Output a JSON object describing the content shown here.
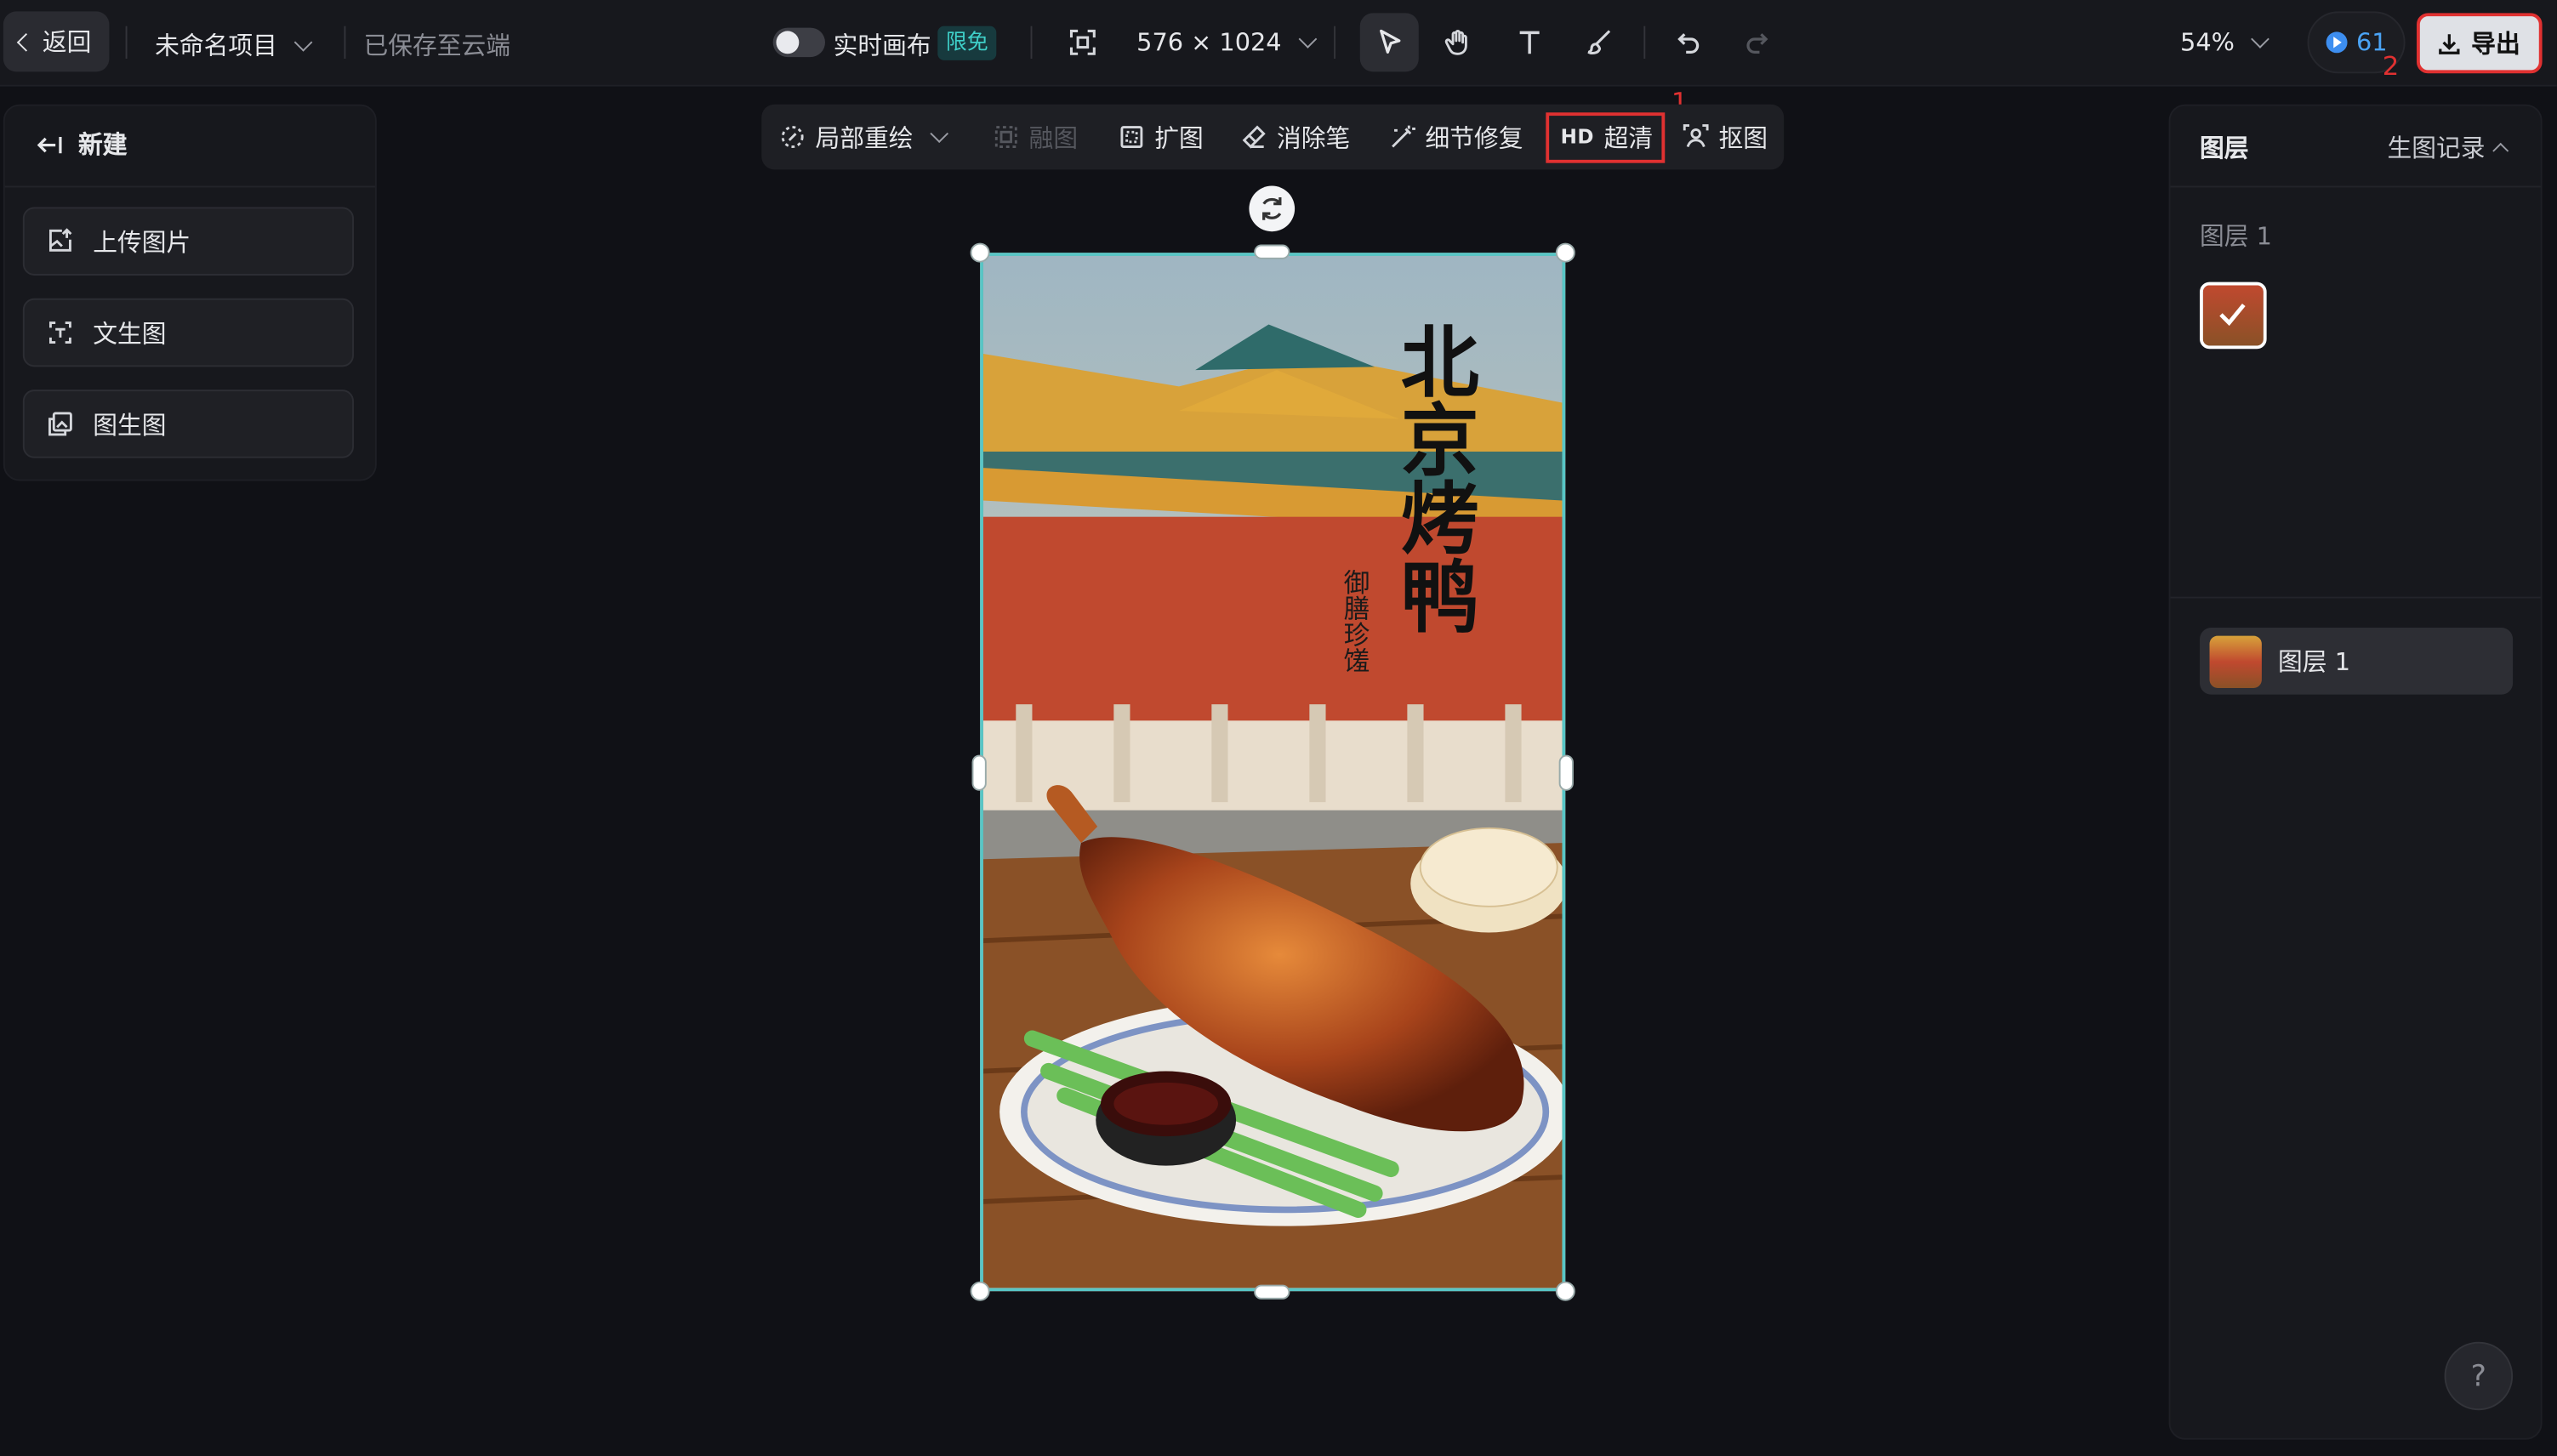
{
  "header": {
    "back_label": "返回",
    "project_name": "未命名项目",
    "save_status": "已保存至云端",
    "realtime_label": "实时画布",
    "free_badge": "限免",
    "canvas_size": "576 × 1024",
    "zoom": "54%",
    "credits": "61",
    "export_label": "导出",
    "annotation_1": "1",
    "annotation_2": "2"
  },
  "left_panel": {
    "title": "新建",
    "items": [
      {
        "label": "上传图片"
      },
      {
        "label": "文生图"
      },
      {
        "label": "图生图"
      }
    ]
  },
  "edit_toolbar": {
    "items": [
      {
        "label": "局部重绘",
        "enabled": true
      },
      {
        "label": "融图",
        "enabled": false
      },
      {
        "label": "扩图",
        "enabled": true
      },
      {
        "label": "消除笔",
        "enabled": true
      },
      {
        "label": "细节修复",
        "enabled": true
      },
      {
        "label": "超清",
        "tag": "HD",
        "enabled": true,
        "highlighted": true
      },
      {
        "label": "抠图",
        "enabled": true
      }
    ]
  },
  "canvas": {
    "title": "北京烤鸭",
    "subtitle": "御膳珍馐"
  },
  "right_panel": {
    "title": "图层",
    "history_label": "生图记录",
    "section_label": "图层 1",
    "layers": [
      {
        "name": "图层 1"
      }
    ]
  },
  "help": {
    "label": "?"
  },
  "colors": {
    "accent": "#3fd0c9",
    "highlight": "#e03131",
    "credit": "#4aa3f5"
  }
}
